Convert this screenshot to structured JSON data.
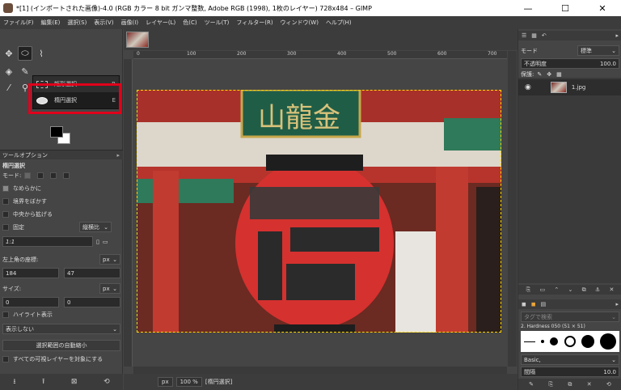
{
  "window": {
    "title": "*[1] (インポートされた画像)-4.0 (RGB カラー 8 bit ガンマ整数, Adobe RGB (1998), 1枚のレイヤー) 728x484 – GIMP",
    "minimize": "—",
    "maximize": "☐",
    "close": "✕"
  },
  "menu": [
    "ファイル(F)",
    "編集(E)",
    "選択(S)",
    "表示(V)",
    "画像(I)",
    "レイヤー(L)",
    "色(C)",
    "ツール(T)",
    "フィルター(R)",
    "ウィンドウ(W)",
    "ヘルプ(H)"
  ],
  "flyout": {
    "items": [
      {
        "label": "矩形選択",
        "key": "R"
      },
      {
        "label": "楕円選択",
        "key": "E"
      }
    ]
  },
  "tool_options": {
    "tab": "ツールオプション",
    "tool_name": "楕円選択",
    "mode_label": "モード:",
    "antialias": "なめらかに",
    "feather": "境界をぼかす",
    "expand_center": "中央から拡げる",
    "fixed": "固定",
    "fixed_combo": "縦横比",
    "ratio": "1:1",
    "position_label": "左上角の座標:",
    "pos_unit": "px",
    "pos_x": "184",
    "pos_y": "47",
    "size_label": "サイズ:",
    "size_unit": "px",
    "size_w": "0",
    "size_h": "0",
    "highlight": "ハイライト表示",
    "guides": "表示しない",
    "auto_shrink": "選択範囲の自動縮小",
    "all_layers": "すべての可視レイヤーを対象にする"
  },
  "rulers": [
    "0",
    "100",
    "200",
    "300",
    "400",
    "500",
    "600",
    "700"
  ],
  "status": {
    "unit": "px",
    "zoom": "100 %",
    "message": "[楕円選択]"
  },
  "layers": {
    "mode_label": "モード",
    "mode_value": "標準",
    "opacity_label": "不透明度",
    "opacity_value": "100.0",
    "lock_label": "保護:",
    "layer_name": "1.jpg"
  },
  "brushes": {
    "tag_placeholder": "タグで検索",
    "brush_name": "2. Hardness 050 (51 × 51)",
    "preset": "Basic,",
    "spacing_label": "間隔",
    "spacing_value": "10.0"
  },
  "photo": {
    "sign_text": "山龍金"
  }
}
